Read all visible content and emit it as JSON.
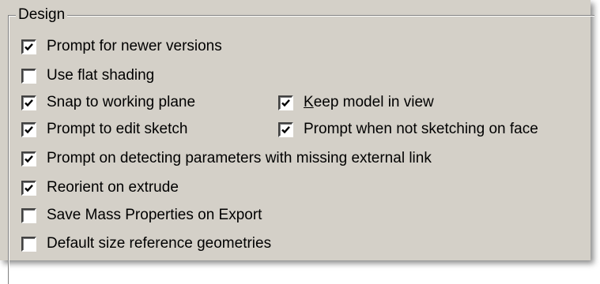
{
  "group": {
    "title": "Design"
  },
  "options": [
    {
      "label": "Prompt for newer versions",
      "checked": true
    },
    {
      "label": "Use flat shading",
      "checked": false
    },
    {
      "label": "Snap to working plane",
      "checked": true
    },
    {
      "label": "Keep model in view",
      "checked": true
    },
    {
      "label": "Prompt to edit sketch",
      "checked": true
    },
    {
      "label": "Prompt when not sketching on face",
      "checked": true
    },
    {
      "label": "Prompt on detecting parameters with missing external link",
      "checked": true
    },
    {
      "label": "Reorient on extrude",
      "checked": true
    },
    {
      "label": "Save Mass Properties on Export",
      "checked": false
    },
    {
      "label": "Default size reference geometries",
      "checked": false
    }
  ],
  "icons": {
    "checked": "checkmark-icon"
  }
}
